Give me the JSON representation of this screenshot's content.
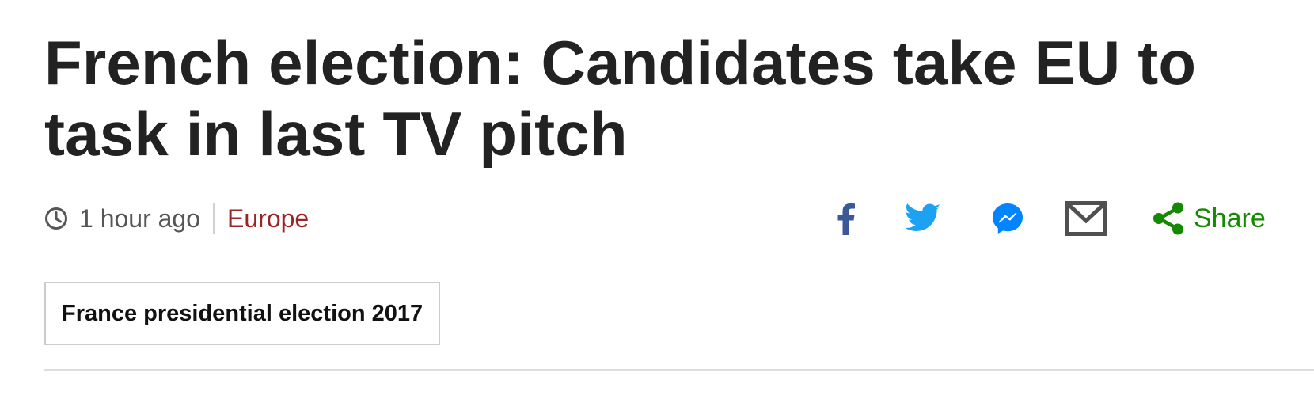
{
  "article": {
    "headline": "French election: Candidates take EU to task in last TV pitch",
    "timestamp": "1 hour ago",
    "section": "Europe",
    "topic_tag": "France presidential election 2017"
  },
  "share": {
    "label": "Share",
    "icons": [
      "facebook-icon",
      "twitter-icon",
      "messenger-icon",
      "email-icon",
      "share-icon"
    ]
  },
  "colors": {
    "headline": "#222222",
    "section": "#9d2425",
    "facebook": "#3b5998",
    "twitter": "#1da1f2",
    "messenger": "#0084ff",
    "email": "#505050",
    "share": "#148a00"
  }
}
